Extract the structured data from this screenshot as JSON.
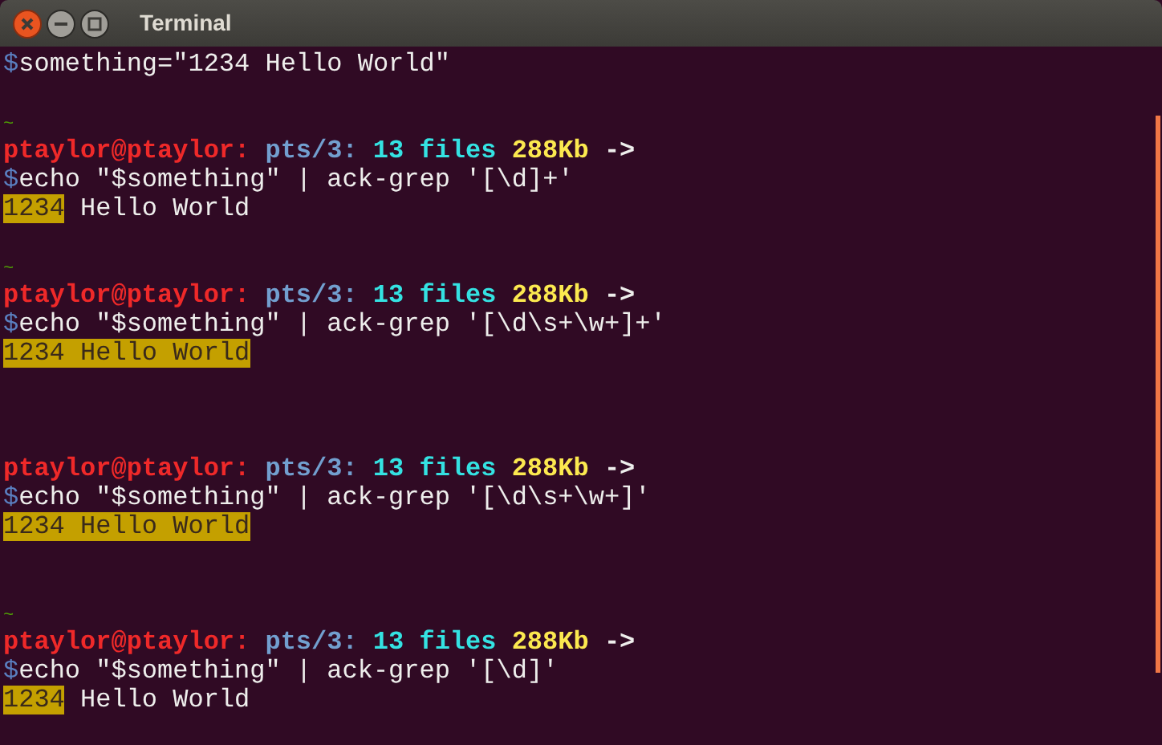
{
  "window": {
    "title": "Terminal"
  },
  "lines": [
    {
      "kind": "assign",
      "sigil": "$",
      "text": "something=\"1234 Hello World\""
    },
    {
      "kind": "blank"
    },
    {
      "kind": "tilde",
      "text": "~"
    },
    {
      "kind": "prompt",
      "segments": [
        {
          "text": "ptaylor@ptaylor:",
          "color": "#ef2929"
        },
        {
          "text": "pts/3:",
          "color": "#729fcf"
        },
        {
          "text": "13 files",
          "color": "#34e2e2"
        },
        {
          "text": "288Kb",
          "color": "#fce94f"
        },
        {
          "text": "->",
          "color": "#eeeeec"
        }
      ]
    },
    {
      "kind": "command",
      "sigil": "$",
      "text": "echo \"$something\" | ack-grep '[\\d]+'"
    },
    {
      "kind": "output",
      "segments": [
        {
          "text": "1234",
          "highlighted": true
        },
        {
          "text": " Hello World",
          "highlighted": false
        }
      ]
    },
    {
      "kind": "blank"
    },
    {
      "kind": "tilde",
      "text": "~"
    },
    {
      "kind": "prompt",
      "segments": [
        {
          "text": "ptaylor@ptaylor:",
          "color": "#ef2929"
        },
        {
          "text": "pts/3:",
          "color": "#729fcf"
        },
        {
          "text": "13 files",
          "color": "#34e2e2"
        },
        {
          "text": "288Kb",
          "color": "#fce94f"
        },
        {
          "text": "->",
          "color": "#eeeeec"
        }
      ]
    },
    {
      "kind": "command",
      "sigil": "$",
      "text": "echo \"$something\" | ack-grep '[\\d\\s+\\w+]+'"
    },
    {
      "kind": "output",
      "segments": [
        {
          "text": "1234 Hello World",
          "highlighted": true
        }
      ]
    },
    {
      "kind": "blank"
    },
    {
      "kind": "blank"
    },
    {
      "kind": "blank"
    },
    {
      "kind": "prompt",
      "segments": [
        {
          "text": "ptaylor@ptaylor:",
          "color": "#ef2929"
        },
        {
          "text": "pts/3:",
          "color": "#729fcf"
        },
        {
          "text": "13 files",
          "color": "#34e2e2"
        },
        {
          "text": "288Kb",
          "color": "#fce94f"
        },
        {
          "text": "->",
          "color": "#eeeeec"
        }
      ]
    },
    {
      "kind": "command",
      "sigil": "$",
      "text": "echo \"$something\" | ack-grep '[\\d\\s+\\w+]'"
    },
    {
      "kind": "output",
      "segments": [
        {
          "text": "1234 Hello World",
          "highlighted": true
        }
      ]
    },
    {
      "kind": "blank"
    },
    {
      "kind": "blank"
    },
    {
      "kind": "tilde",
      "text": "~"
    },
    {
      "kind": "prompt",
      "segments": [
        {
          "text": "ptaylor@ptaylor:",
          "color": "#ef2929"
        },
        {
          "text": "pts/3:",
          "color": "#729fcf"
        },
        {
          "text": "13 files",
          "color": "#34e2e2"
        },
        {
          "text": "288Kb",
          "color": "#fce94f"
        },
        {
          "text": "->",
          "color": "#eeeeec"
        }
      ]
    },
    {
      "kind": "command",
      "sigil": "$",
      "text": "echo \"$something\" | ack-grep '[\\d]'"
    },
    {
      "kind": "output",
      "segments": [
        {
          "text": "1234",
          "highlighted": true
        },
        {
          "text": " Hello World",
          "highlighted": false
        }
      ]
    }
  ]
}
